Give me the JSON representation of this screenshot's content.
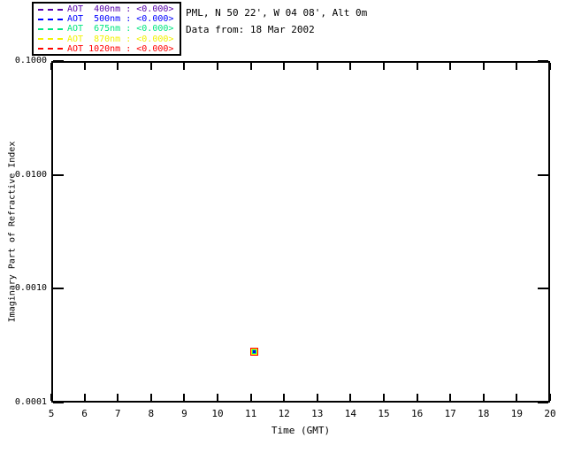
{
  "header": {
    "location": "PML, N 50 22', W 04 08', Alt 0m",
    "date": "Data from: 18 Mar 2002"
  },
  "legend": {
    "items": [
      {
        "text": "AOT  400nm : <0.000>",
        "color": "#5500AA"
      },
      {
        "text": "AOT  500nm : <0.000>",
        "color": "#0000FF"
      },
      {
        "text": "AOT  675nm : <0.000>",
        "color": "#00E682"
      },
      {
        "text": "AOT  870nm : <0.000>",
        "color": "#F2F200"
      },
      {
        "text": "AOT 1020nm : <0.000>",
        "color": "#FF0000"
      }
    ]
  },
  "chart_data": {
    "type": "scatter",
    "title": "",
    "xlabel": "Time (GMT)",
    "ylabel": "Imaginary Part of Refractive Index",
    "xlim": [
      5,
      20
    ],
    "ylim": [
      0.0001,
      0.1
    ],
    "yscale": "log",
    "grid": false,
    "legend_position": "outside-top-left",
    "x_ticks": [
      5,
      6,
      7,
      8,
      9,
      10,
      11,
      12,
      13,
      14,
      15,
      16,
      17,
      18,
      19,
      20
    ],
    "y_ticks": [
      {
        "value": 0.1,
        "label": "0.1000"
      },
      {
        "value": 0.01,
        "label": "0.0100"
      },
      {
        "value": 0.001,
        "label": "0.0010"
      },
      {
        "value": 0.0001,
        "label": "0.0001"
      }
    ],
    "series": [
      {
        "name": "AOT 400nm",
        "color": "#5500AA",
        "points": [
          {
            "x": 11.1,
            "y": 0.00028
          }
        ]
      },
      {
        "name": "AOT 500nm",
        "color": "#0000FF",
        "points": [
          {
            "x": 11.1,
            "y": 0.00028
          }
        ]
      },
      {
        "name": "AOT 675nm",
        "color": "#00E682",
        "points": [
          {
            "x": 11.1,
            "y": 0.00028
          }
        ]
      },
      {
        "name": "AOT 870nm",
        "color": "#F2F200",
        "points": [
          {
            "x": 11.1,
            "y": 0.00028
          }
        ]
      },
      {
        "name": "AOT 1020nm",
        "color": "#FF0000",
        "points": [
          {
            "x": 11.1,
            "y": 0.00028
          }
        ]
      }
    ]
  }
}
